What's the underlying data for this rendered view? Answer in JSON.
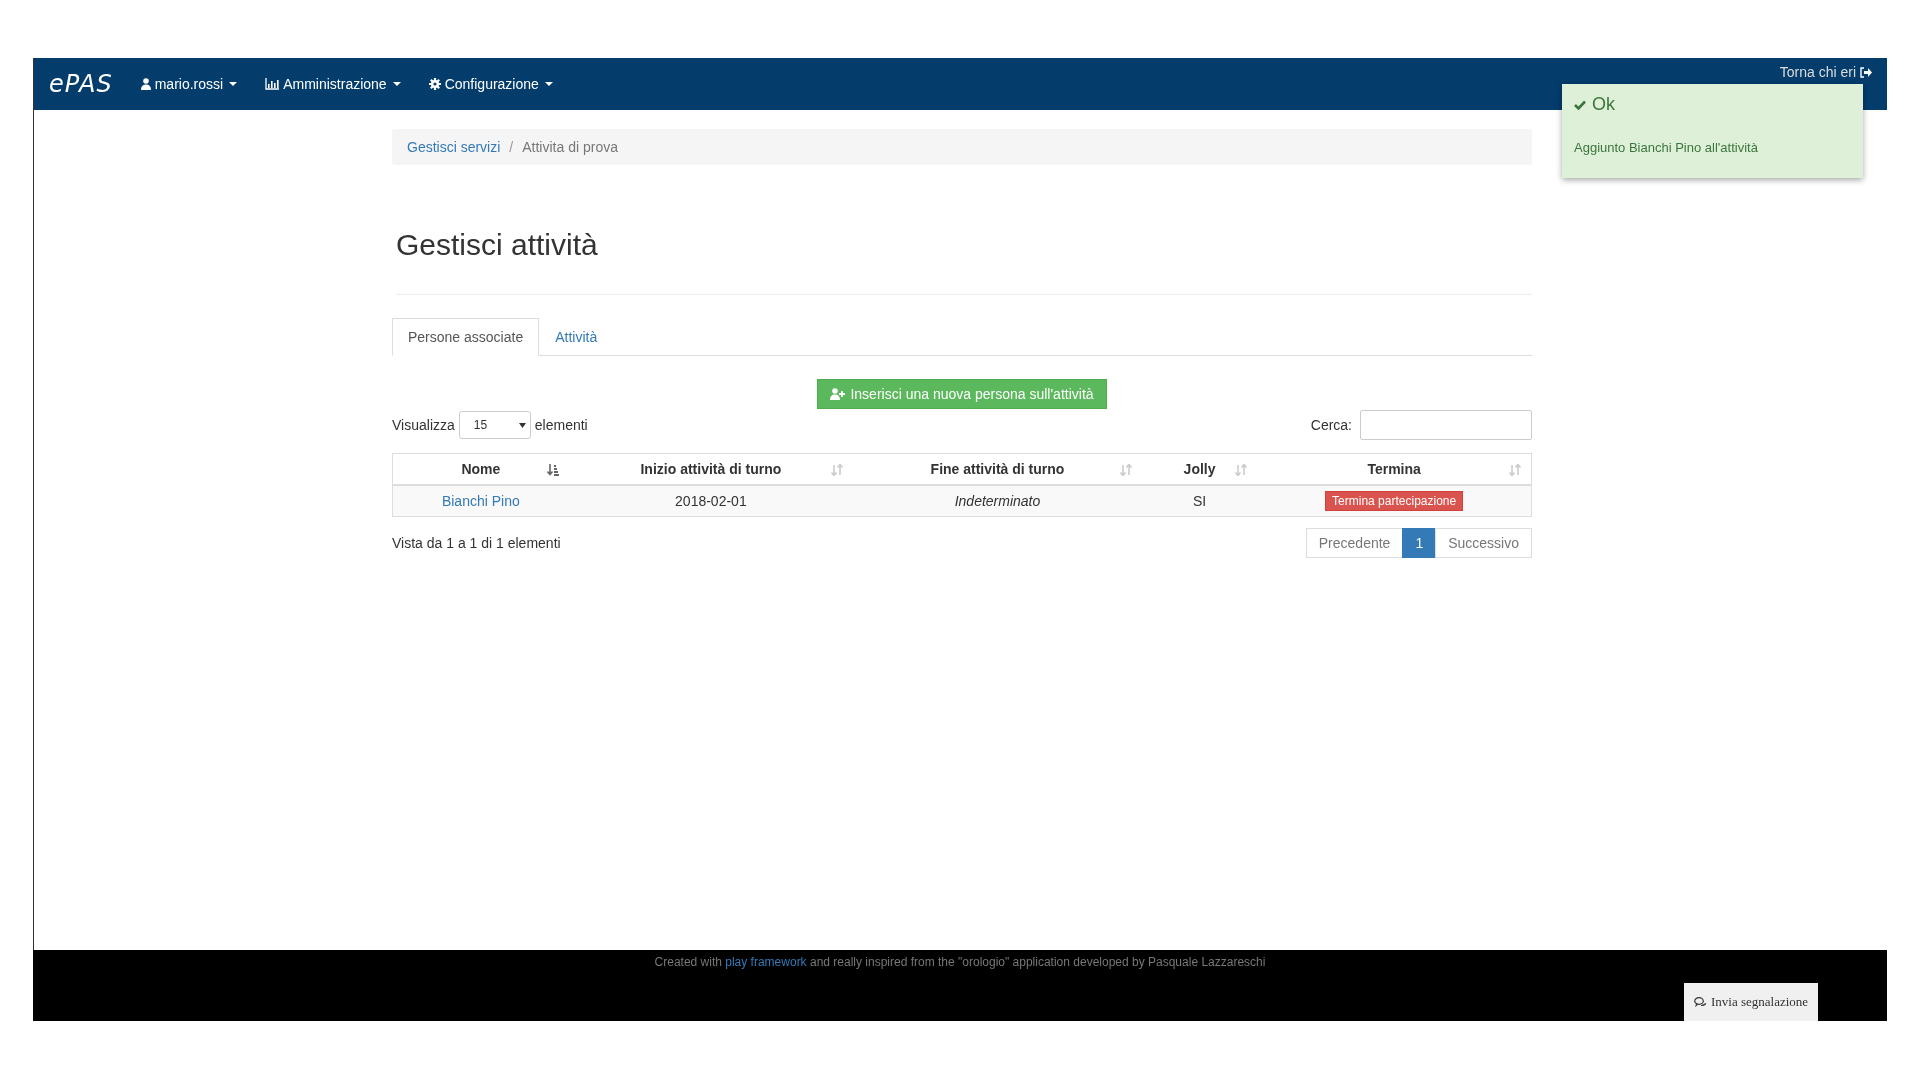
{
  "navbar": {
    "brand": "ePAS",
    "menus": [
      {
        "kind": "user",
        "label": "mario.rossi"
      },
      {
        "kind": "chart",
        "label": "Amministrazione"
      },
      {
        "kind": "gear",
        "label": "Configurazione"
      }
    ],
    "right_link": "Torna chi eri"
  },
  "toast": {
    "title": "Ok",
    "message": "Aggiunto Bianchi Pino all'attività"
  },
  "breadcrumb": [
    {
      "label": "Gestisci servizi",
      "link": true
    },
    {
      "label": "Attivita di prova",
      "link": false
    }
  ],
  "breadcrumb_separator": "/",
  "title": "Gestisci attività",
  "tabs": [
    {
      "label": "Persone associate",
      "selected": true
    },
    {
      "label": "Attività",
      "selected": false
    }
  ],
  "add_button": "Inserisci una nuova persona sull'attività",
  "length": {
    "before": "Visualizza",
    "value": "15",
    "after": "elementi"
  },
  "search": {
    "label": "Cerca:"
  },
  "table": {
    "columns": [
      {
        "label": "Nome",
        "sorted": true
      },
      {
        "label": "Inizio attività di turno",
        "sorted": false
      },
      {
        "label": "Fine attività di turno",
        "sorted": false
      },
      {
        "label": "Jolly",
        "sorted": false
      },
      {
        "label": "Termina",
        "sorted": false
      }
    ],
    "rows": [
      {
        "name": "Bianchi Pino",
        "start": "2018-02-01",
        "end": "Indeterminato",
        "jolly": "SI",
        "action": "Termina partecipazione"
      }
    ]
  },
  "info": "Vista da 1 a 1 di 1 elementi",
  "pagination": [
    {
      "label": "Precedente",
      "selected": false
    },
    {
      "label": "1",
      "selected": true
    },
    {
      "label": "Successivo",
      "selected": false
    }
  ],
  "footer": {
    "before": "Created with ",
    "link": "play framework",
    "after": " and really inspired from the \"orologio\" application developed by Pasquale Lazzareschi",
    "button": "Invia segnalazione"
  }
}
